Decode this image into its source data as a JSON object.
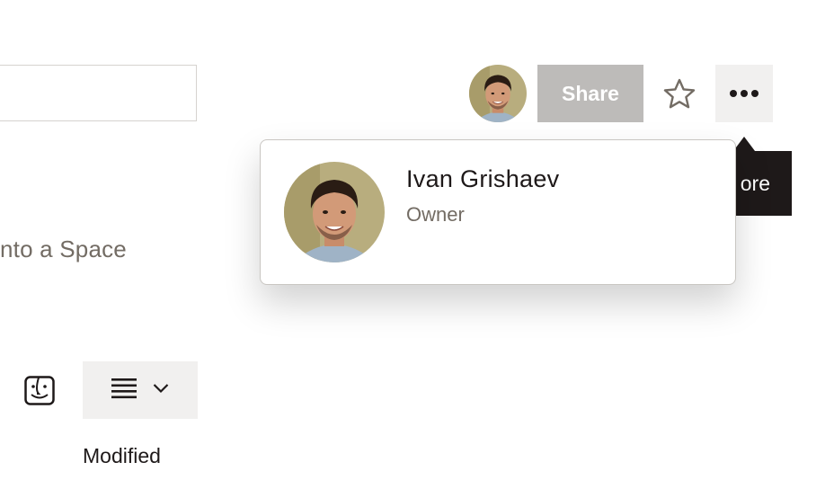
{
  "left_panel": {
    "search": {
      "value": "",
      "placeholder": ""
    },
    "space_text": "nto a Space",
    "finder_icon": "finder-icon",
    "view_menu_icon": "list-view-icon",
    "view_chevron_icon": "chevron-down-icon",
    "column_header": "Modified"
  },
  "header": {
    "share_label": "Share",
    "star_icon": "star-icon",
    "more_icon": "more-icon",
    "tooltip_text": "ore"
  },
  "member_popover": {
    "name": "Ivan Grishaev",
    "role": "Owner"
  },
  "colors": {
    "share_disabled": "#bdbbb9",
    "button_bg": "#f1f0ef",
    "tooltip_bg": "#1e1919",
    "muted_text": "#736c64"
  }
}
